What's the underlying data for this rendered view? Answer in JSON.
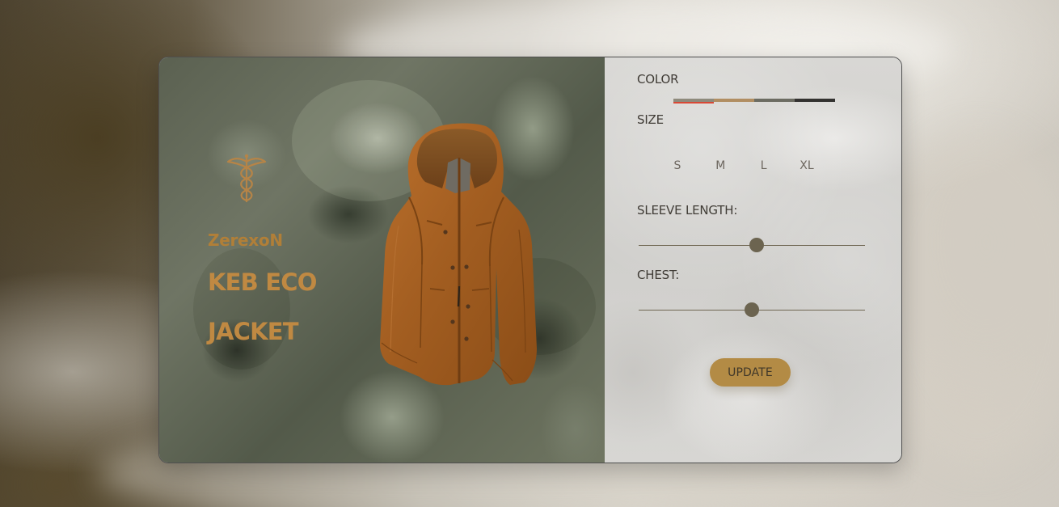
{
  "brand": {
    "name": "ZerexoN",
    "icon": "caduceus-icon"
  },
  "product": {
    "title_line_1": "KEB ECO",
    "title_line_2": "JACKET",
    "image": "jacket-image"
  },
  "config": {
    "color_label": "COLOR",
    "size_label": "SIZE",
    "sleeve_label": "SLEEVE LENGTH:",
    "chest_label": "CHEST:",
    "color_options": [
      {
        "name": "olive-gray",
        "hex": "#8e8a7c"
      },
      {
        "name": "tan",
        "hex": "#b18e62"
      },
      {
        "name": "moss-gray",
        "hex": "#6c6c62"
      },
      {
        "name": "charcoal",
        "hex": "#333230"
      }
    ],
    "selected_color_index": 0,
    "sizes": [
      "S",
      "M",
      "L",
      "XL"
    ],
    "sleeve_value": 0.52,
    "chest_value": 0.5,
    "button_label": "UPDATE"
  },
  "colors": {
    "accent": "#c08942",
    "button": "#b38b45",
    "selected_swatch_marker": "#d94835"
  }
}
